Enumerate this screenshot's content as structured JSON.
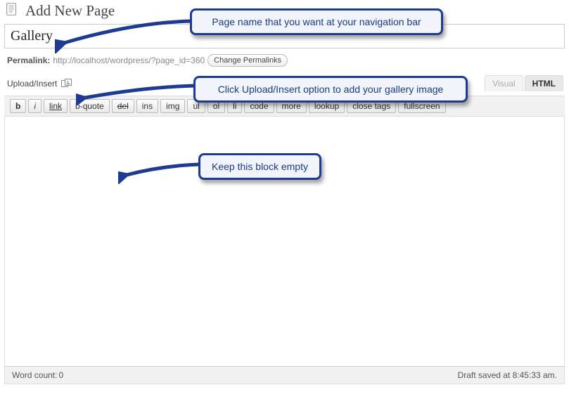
{
  "header": {
    "title": "Add New Page"
  },
  "titleField": {
    "value": "Gallery"
  },
  "permalink": {
    "label": "Permalink:",
    "url": "http://localhost/wordpress/?page_id=360",
    "change_btn": "Change Permalinks"
  },
  "media": {
    "label": "Upload/Insert"
  },
  "editorTabs": {
    "visual": "Visual",
    "html": "HTML"
  },
  "toolbar": {
    "buttons": [
      "b",
      "i",
      "link",
      "b-quote",
      "del",
      "ins",
      "img",
      "ul",
      "ol",
      "li",
      "code",
      "more",
      "lookup",
      "close tags",
      "fullscreen"
    ]
  },
  "status": {
    "word_count_label": "Word count:",
    "word_count_value": "0",
    "draft_saved": "Draft saved at 8:45:33 am."
  },
  "callouts": {
    "c1": "Page name that you want at your navigation bar",
    "c2": "Click Upload/Insert option to add your gallery image",
    "c3": "Keep this block empty"
  }
}
